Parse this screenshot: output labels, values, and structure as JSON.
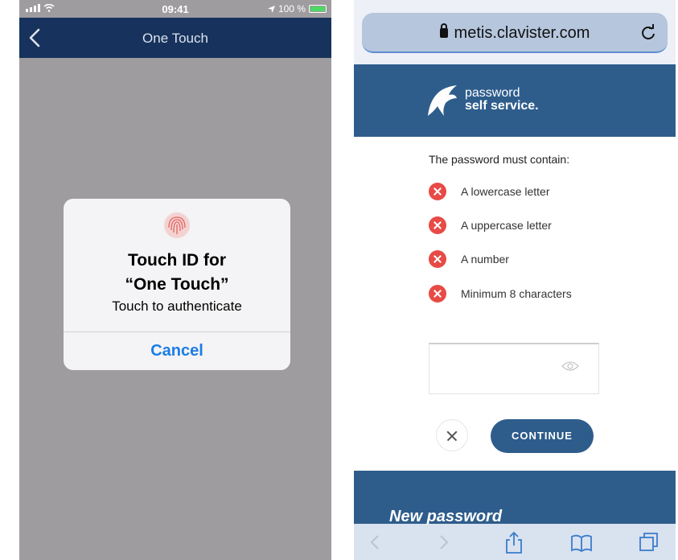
{
  "left_phone": {
    "status_bar": {
      "time": "09:41",
      "battery": "100 %",
      "battery_level": 1.0
    },
    "nav": {
      "title": "One Touch"
    },
    "dialog": {
      "title_line1": "Touch ID for",
      "title_line2": "“One Touch”",
      "message": "Touch to authenticate",
      "cancel_label": "Cancel"
    }
  },
  "right_phone": {
    "url": "metis.clavister.com",
    "brand": {
      "line1": "password",
      "line2": "self service."
    },
    "requirements_title": "The password must contain:",
    "requirements": [
      {
        "label": "A lowercase letter",
        "status": "unmet"
      },
      {
        "label": "A uppercase letter",
        "status": "unmet"
      },
      {
        "label": "A number",
        "status": "unmet"
      },
      {
        "label": "Minimum 8 characters",
        "status": "unmet"
      }
    ],
    "continue_label": "CONTINUE",
    "footer_heading": "New password"
  },
  "colors": {
    "nav_dark_blue": "#17325c",
    "brand_blue": "#2e5d8c",
    "error_red": "#e84a45",
    "ios_blue": "#1c7de6"
  }
}
